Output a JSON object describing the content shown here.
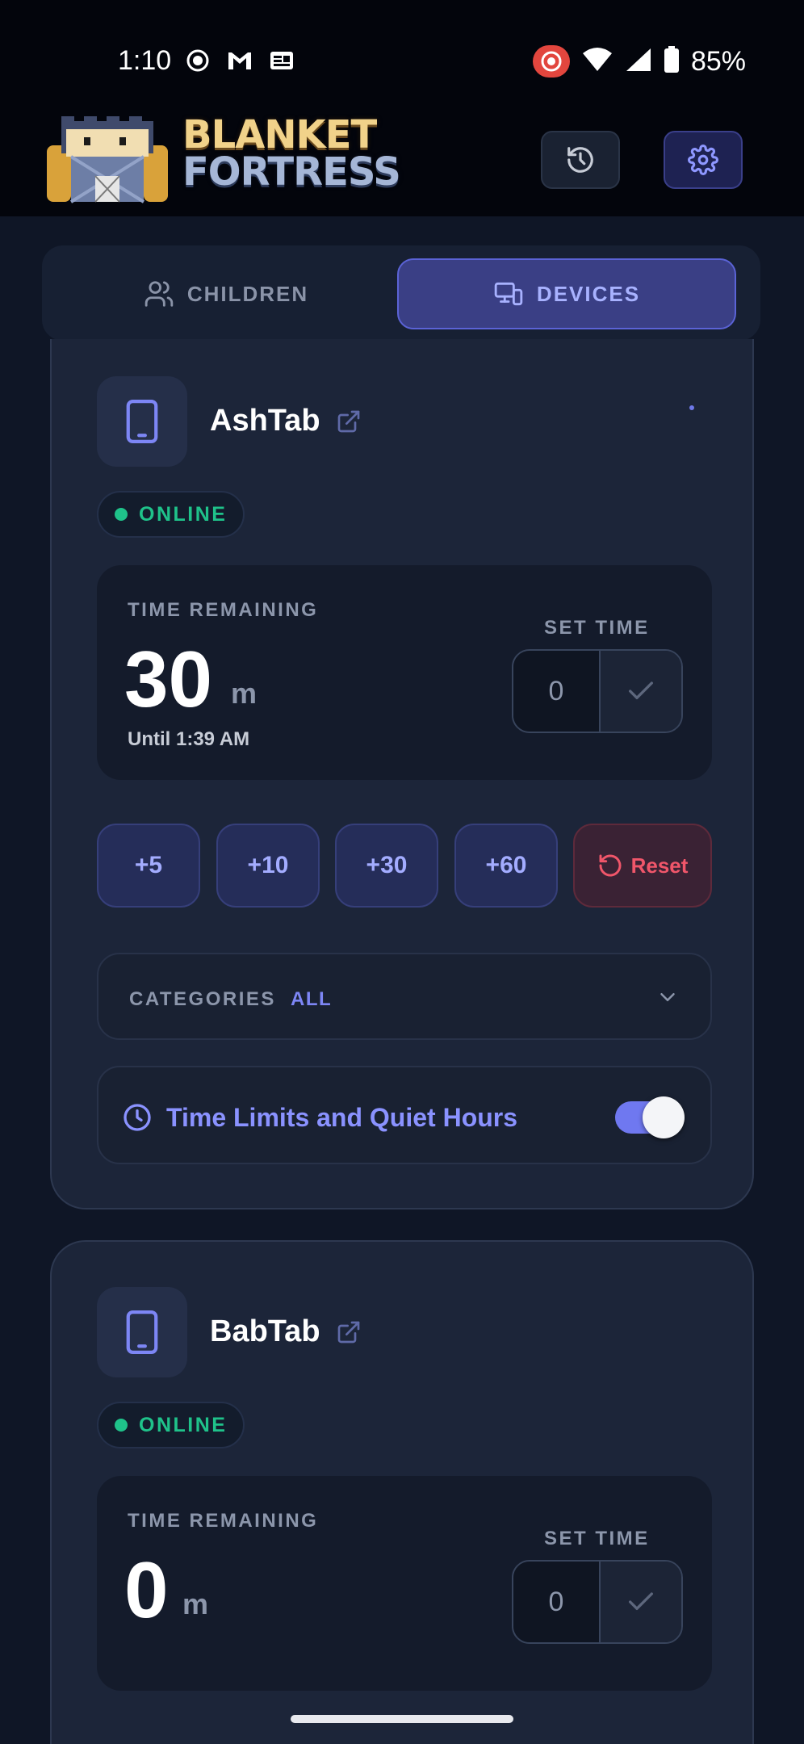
{
  "status_bar": {
    "time": "1:10",
    "battery": "85%",
    "left_icons": [
      "record-icon",
      "gmail-icon",
      "news-icon"
    ],
    "right_icons": [
      "screen-record-icon",
      "wifi-icon",
      "signal-icon",
      "battery-icon"
    ]
  },
  "header": {
    "logo_line1": "BLANKET",
    "logo_line2": "FORTRESS"
  },
  "tabs": [
    {
      "label": "CHILDREN",
      "icon": "users-icon",
      "active": false
    },
    {
      "label": "DEVICES",
      "icon": "devices-icon",
      "active": true
    }
  ],
  "devices": [
    {
      "name": "AshTab",
      "status": "ONLINE",
      "time_remaining_label": "TIME REMAINING",
      "time_value": "30",
      "time_unit": "m",
      "until": "Until 1:39 AM",
      "set_time_label": "SET TIME",
      "set_time_value": "0",
      "quick_add": [
        "+5",
        "+10",
        "+30",
        "+60"
      ],
      "reset_label": "Reset",
      "categories_label": "CATEGORIES",
      "categories_value": "ALL",
      "time_limits_label": "Time Limits and Quiet Hours",
      "time_limits_enabled": true
    },
    {
      "name": "BabTab",
      "status": "ONLINE",
      "time_remaining_label": "TIME REMAINING",
      "time_value": "0",
      "time_unit": "m",
      "set_time_label": "SET TIME",
      "set_time_value": "0"
    }
  ],
  "colors": {
    "accent": "#7d86f5",
    "online": "#1fc28a",
    "reset": "#f0566a",
    "background": "#0f1626"
  }
}
